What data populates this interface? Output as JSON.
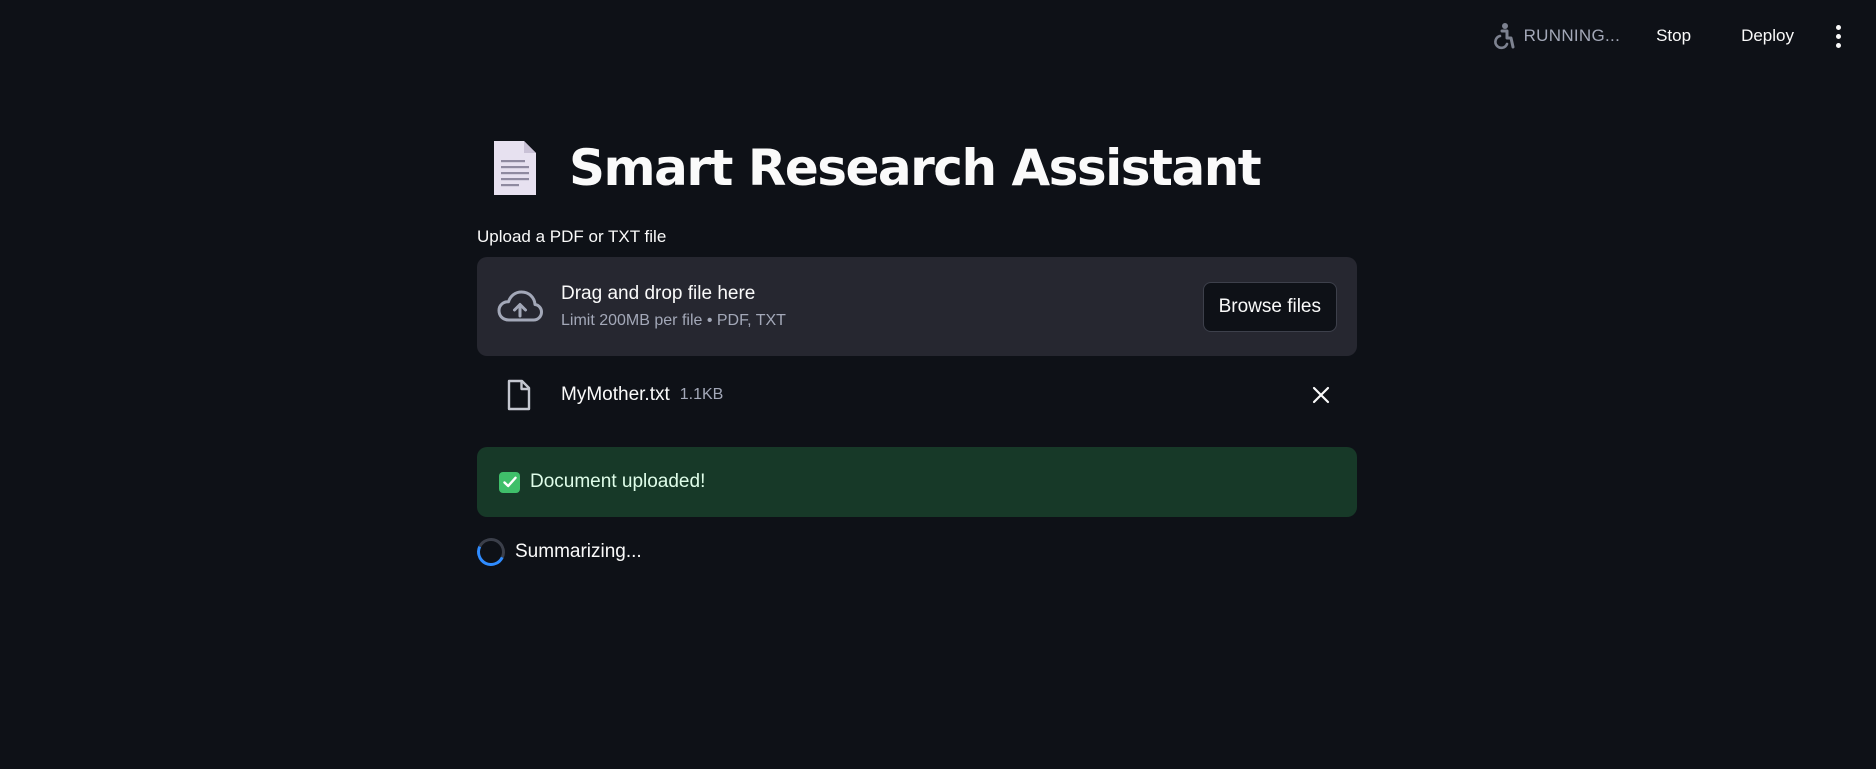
{
  "header": {
    "status_text": "RUNNING...",
    "stop_label": "Stop",
    "deploy_label": "Deploy",
    "status_icon": "running-person-icon",
    "menu_icon": "vertical-dots-icon"
  },
  "main": {
    "title_icon": "page-facing-up-emoji",
    "title": "Smart Research Assistant",
    "uploader": {
      "label": "Upload a PDF or TXT file",
      "dropzone_title": "Drag and drop file here",
      "dropzone_subtitle": "Limit 200MB per file • PDF, TXT",
      "browse_label": "Browse files",
      "upload_icon": "cloud-upload-icon"
    },
    "uploaded_file": {
      "name": "MyMother.txt",
      "size": "1.1KB",
      "file_icon": "file-icon",
      "remove_icon": "close-icon"
    },
    "success_alert": {
      "icon": "check-mark-button-emoji",
      "text": "Document uploaded!"
    },
    "spinner": {
      "text": "Summarizing..."
    }
  },
  "colors": {
    "background": "#0e1117",
    "dropzone_bg": "#262730",
    "success_bg": "#173928",
    "success_text": "#dffde9",
    "muted_text": "#a3a8b8",
    "spinner_accent": "#2f8cff"
  }
}
